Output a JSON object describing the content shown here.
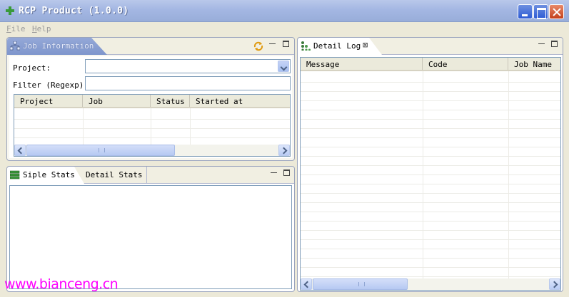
{
  "window": {
    "title": "RCP Product (1.0.0)"
  },
  "menu": {
    "file": "File",
    "file_mnemonic": "F",
    "file_rest": "ile",
    "help": "Help",
    "help_mnemonic": "H",
    "help_rest": "elp"
  },
  "job_panel": {
    "tab": "Job Information",
    "project_label": "Project:",
    "project_value": "",
    "filter_label": "Filter (Regexp):",
    "filter_value": "",
    "columns": [
      "Project",
      "Job",
      "Status",
      "Started at"
    ]
  },
  "stats_panel": {
    "tabs": [
      "Siple Stats",
      "Detail Stats"
    ]
  },
  "log_panel": {
    "tab": "Detail Log",
    "columns": [
      "Message",
      "Code",
      "Job Name"
    ]
  },
  "watermark": "www.bianceng.cn",
  "colors": {
    "accent_tab": "#8aa0d2",
    "watermark": "#ff00ff",
    "title_text": "#ffffff"
  }
}
